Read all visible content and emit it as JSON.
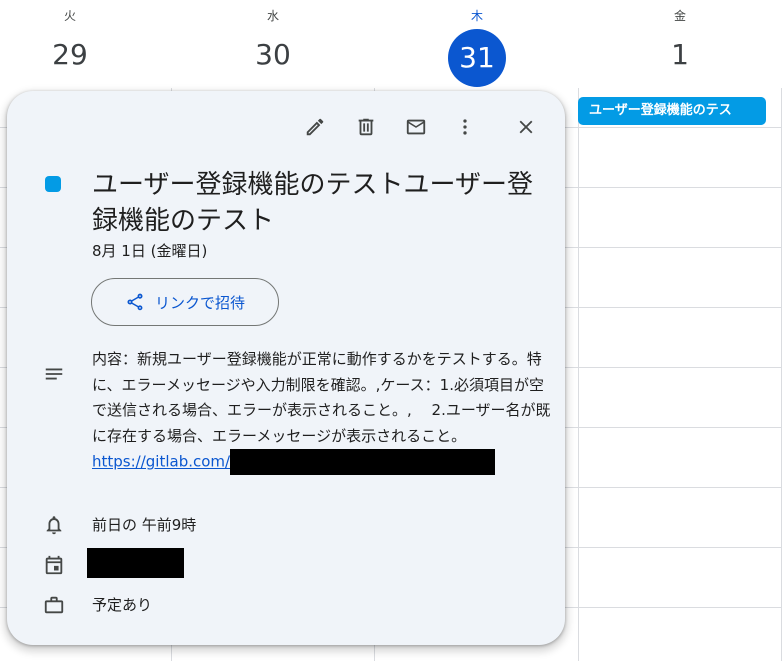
{
  "calendar": {
    "days": [
      {
        "dow": "火",
        "num": "29"
      },
      {
        "dow": "水",
        "num": "30"
      },
      {
        "dow": "木",
        "num": "31",
        "today": true
      },
      {
        "dow": "金",
        "num": "1"
      }
    ],
    "event_chip": "ユーザー登録機能のテス"
  },
  "popup": {
    "toolbar": {
      "edit_icon": "pencil-icon",
      "delete_icon": "trash-icon",
      "email_icon": "mail-icon",
      "more_icon": "more-vert-icon",
      "close_icon": "close-icon"
    },
    "color": "#039be5",
    "title": "ユーザー登録機能のテストユーザー登録機能のテスト",
    "date": "8月 1日 (金曜日)",
    "invite_label": "リンクで招待",
    "description": {
      "text": "内容：新規ユーザー登録機能が正常に動作するかをテストする。特に、エラーメッセージや入力制限を確認。,ケース：1.必須項目が空で送信される場合、エラーが表示されること。,　 2.ユーザー名が既に存在する場合、エラーメッセージが表示されること。",
      "link": "https://gitlab.com/"
    },
    "reminder": "前日の 午前9時",
    "availability": "予定あり"
  },
  "colors": {
    "accent": "#0b57d0",
    "event": "#039be5",
    "popup_bg": "#f0f4f9"
  }
}
